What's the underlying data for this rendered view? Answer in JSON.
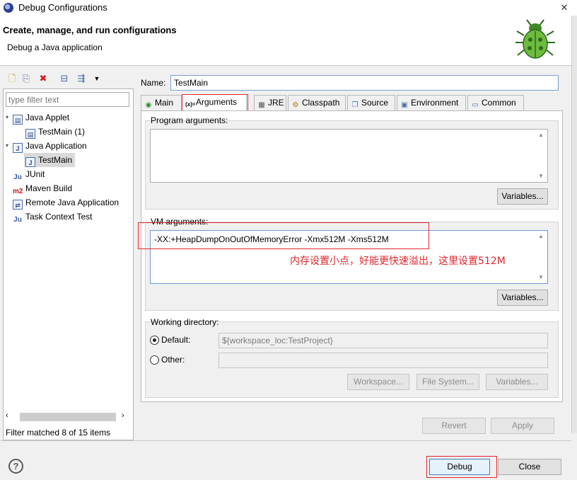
{
  "window": {
    "title": "Debug Configurations",
    "close_glyph": "✕"
  },
  "header": {
    "title": "Create, manage, and run configurations",
    "subtitle": "Debug a Java application"
  },
  "left": {
    "filter_placeholder": "type filter text",
    "tree": [
      {
        "label": "Java Applet",
        "level": 0,
        "icon": "applet-icon"
      },
      {
        "label": "TestMain (1)",
        "level": 1,
        "icon": "applet-config-icon"
      },
      {
        "label": "Java Application",
        "level": 0,
        "icon": "java-app-icon"
      },
      {
        "label": "TestMain",
        "level": 1,
        "icon": "java-config-icon",
        "selected": true
      },
      {
        "label": "JUnit",
        "level": 0,
        "icon": "junit-icon"
      },
      {
        "label": "Maven Build",
        "level": 0,
        "icon": "maven-icon"
      },
      {
        "label": "Remote Java Application",
        "level": 0,
        "icon": "remote-java-icon"
      },
      {
        "label": "Task Context Test",
        "level": 0,
        "icon": "task-context-icon"
      }
    ],
    "status": "Filter matched 8 of 15 items"
  },
  "config": {
    "name_label": "Name:",
    "name_value": "TestMain",
    "tabs": [
      {
        "label": "Main",
        "icon": "main-tab-icon"
      },
      {
        "label": "Arguments",
        "icon": "arguments-tab-icon",
        "active": true
      },
      {
        "label": "JRE",
        "icon": "jre-tab-icon"
      },
      {
        "label": "Classpath",
        "icon": "classpath-tab-icon"
      },
      {
        "label": "Source",
        "icon": "source-tab-icon"
      },
      {
        "label": "Environment",
        "icon": "environment-tab-icon"
      },
      {
        "label": "Common",
        "icon": "common-tab-icon"
      }
    ],
    "program_args_label": "Program arguments:",
    "program_args_value": "",
    "variables_label": "Variables...",
    "vm_args_label": "VM arguments:",
    "vm_args_value": "-XX:+HeapDumpOnOutOfMemoryError -Xmx512M -Xms512M",
    "vm_note": "内存设置小点，好能更快速溢出，这里设置512M",
    "working_dir_label": "Working directory:",
    "default_label": "Default:",
    "default_value": "${workspace_loc:TestProject}",
    "other_label": "Other:",
    "other_value": "",
    "workspace_btn": "Workspace...",
    "filesystem_btn": "File System...",
    "variables_btn2": "Variables..."
  },
  "actions": {
    "revert": "Revert",
    "apply": "Apply",
    "debug": "Debug",
    "close": "Close",
    "help": "?"
  },
  "colors": {
    "annotation_red": "#e0262c",
    "selection": "#d9d9d9"
  }
}
